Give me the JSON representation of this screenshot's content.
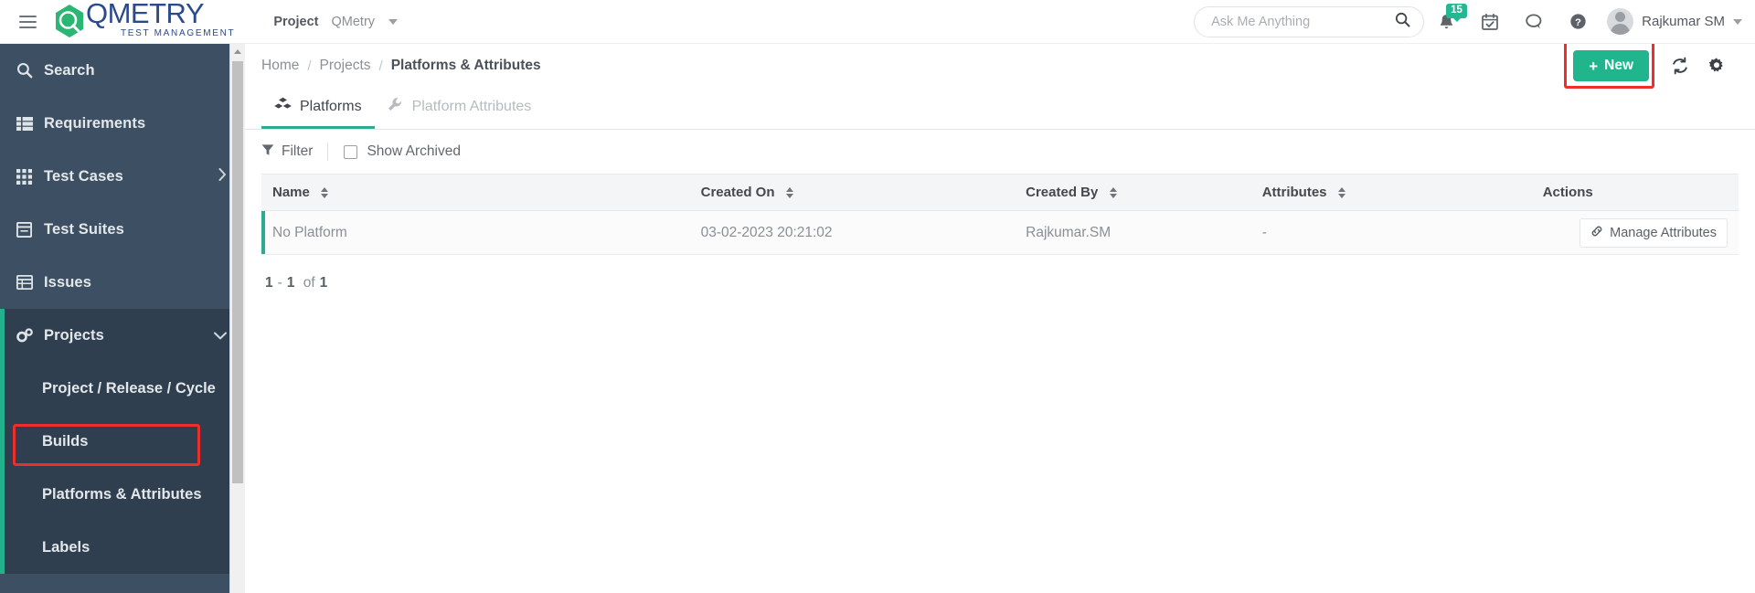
{
  "topbar": {
    "menu_icon": "hamburger-icon",
    "logo_word": "QMETRY",
    "logo_tagline": "TEST MANAGEMENT",
    "project_label": "Project",
    "project_value": "QMetry",
    "search_placeholder": "Ask Me Anything",
    "search_value": "",
    "search_icon": "search-icon",
    "notification_icon": "bell-icon",
    "notification_count": "15",
    "calendar_icon": "calendar-check-icon",
    "chat_icon": "chat-bubble-icon",
    "help_icon": "question-circle-icon",
    "avatar_icon": "user-avatar",
    "username": "Rajkumar SM"
  },
  "sidebar": {
    "items": [
      {
        "label": "Search",
        "icon": "search-icon",
        "has_arrow": false
      },
      {
        "label": "Requirements",
        "icon": "list-icon",
        "has_arrow": false
      },
      {
        "label": "Test Cases",
        "icon": "grid-icon",
        "has_arrow": true
      },
      {
        "label": "Test Suites",
        "icon": "window-icon",
        "has_arrow": false
      },
      {
        "label": "Issues",
        "icon": "table-icon",
        "has_arrow": false
      }
    ],
    "projects": {
      "label": "Projects",
      "icon": "gears-icon",
      "expanded": true,
      "chevron_icon": "chevron-down-icon",
      "children": [
        {
          "label": "Project / Release / Cycle",
          "selected": false
        },
        {
          "label": "Builds",
          "selected": false
        },
        {
          "label": "Platforms & Attributes",
          "selected": true
        },
        {
          "label": "Labels",
          "selected": false
        }
      ]
    },
    "scrollbar_up_icon": "scroll-up-arrow"
  },
  "breadcrumb": {
    "items": [
      "Home",
      "Projects",
      "Platforms & Attributes"
    ],
    "separator": "/"
  },
  "page_actions": {
    "new_label": "New",
    "new_plus": "+",
    "refresh_icon": "refresh-icon",
    "settings_icon": "gear-icon"
  },
  "tabs": [
    {
      "label": "Platforms",
      "icon": "cubes-icon",
      "active": true
    },
    {
      "label": "Platform Attributes",
      "icon": "wrench-icon",
      "active": false
    }
  ],
  "toolbar": {
    "filter_label": "Filter",
    "filter_icon": "funnel-icon",
    "show_archived_label": "Show Archived",
    "show_archived_checked": false
  },
  "table": {
    "columns": [
      {
        "label": "Name",
        "sortable": true
      },
      {
        "label": "Created On",
        "sortable": true
      },
      {
        "label": "Created By",
        "sortable": true
      },
      {
        "label": "Attributes",
        "sortable": true
      },
      {
        "label": "Actions",
        "sortable": false
      }
    ],
    "rows": [
      {
        "name": "No Platform",
        "created_on": "03-02-2023 20:21:02",
        "created_by": "Rajkumar.SM",
        "attributes": "-",
        "action_label": "Manage Attributes",
        "action_icon": "link-chain-icon"
      }
    ]
  },
  "pagination": {
    "from": "1",
    "dash": "-",
    "to": "1",
    "of_word": "of",
    "total": "1"
  },
  "colors": {
    "brand_green": "#2bb673",
    "brand_blue": "#2b4a8b",
    "accent_teal": "#21b58e",
    "sidebar_bg": "#3d5063",
    "sidebar_active_bg": "#2f3f4f",
    "annotation_red": "#ee2d2d"
  }
}
